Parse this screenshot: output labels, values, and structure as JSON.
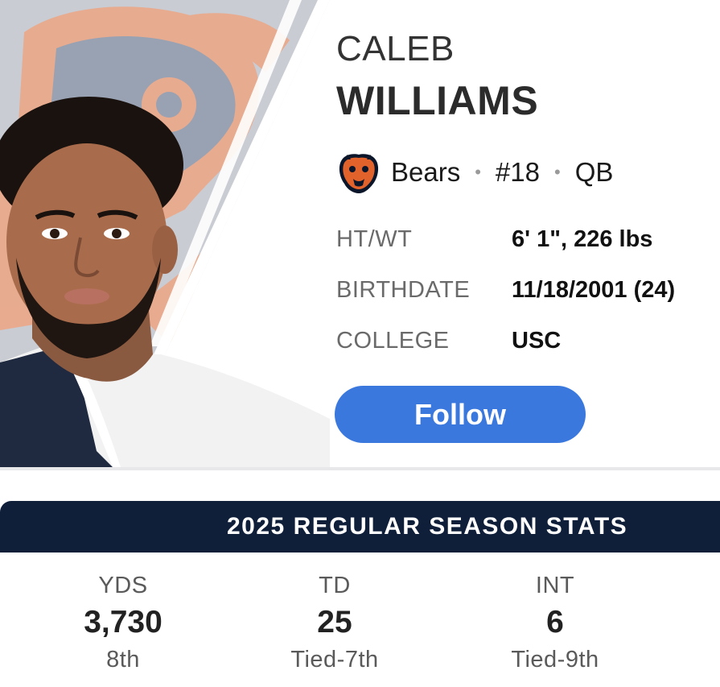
{
  "player": {
    "first_name": "CALEB",
    "last_name": "WILLIAMS",
    "team": "Bears",
    "number": "#18",
    "position": "QB",
    "separator": "•",
    "team_logo_icon": "bears-logo-icon"
  },
  "details": [
    {
      "label": "HT/WT",
      "value": "6' 1\", 226 lbs"
    },
    {
      "label": "BIRTHDATE",
      "value": "11/18/2001 (24)"
    },
    {
      "label": "COLLEGE",
      "value": "USC"
    }
  ],
  "follow_button": {
    "label": "Follow"
  },
  "stats": {
    "header": "2025 REGULAR SEASON STATS",
    "items": [
      {
        "label": "YDS",
        "value": "3,730",
        "rank": "8th"
      },
      {
        "label": "TD",
        "value": "25",
        "rank": "Tied-7th"
      },
      {
        "label": "INT",
        "value": "6",
        "rank": "Tied-9th"
      }
    ]
  },
  "colors": {
    "follow_button": "#3a78de",
    "stats_header_bg": "#0f1e39",
    "team_orange": "#e1622a",
    "team_navy": "#0b162a"
  }
}
